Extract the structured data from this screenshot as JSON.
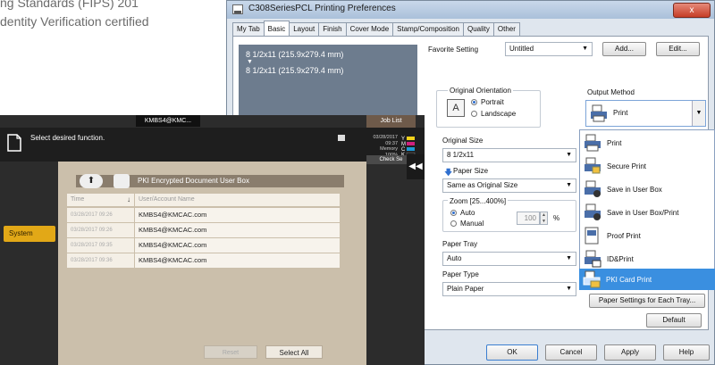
{
  "background": {
    "line1": "ng Standards (FIPS) 201",
    "line2": "dentity Verification certified"
  },
  "dialog": {
    "title": "C308SeriesPCL Printing Preferences",
    "close_label": "x",
    "tabs": [
      "My Tab",
      "Basic",
      "Layout",
      "Finish",
      "Cover Mode",
      "Stamp/Composition",
      "Quality",
      "Other"
    ],
    "active_tab": "Basic",
    "preview_line1": "8 1/2x11 (215.9x279.4 mm)",
    "preview_line2": "8 1/2x11 (215.9x279.4 mm)",
    "favorite_label": "Favorite Setting",
    "favorite_value": "Untitled",
    "add_button": "Add...",
    "edit_button": "Edit...",
    "orientation_label": "Original Orientation",
    "portrait_label": "Portrait",
    "landscape_label": "Landscape",
    "original_size_label": "Original Size",
    "original_size_value": "8 1/2x11",
    "paper_size_label": "Paper Size",
    "paper_size_value": "Same as Original Size",
    "zoom_label": "Zoom [25...400%]",
    "zoom_auto": "Auto",
    "zoom_manual": "Manual",
    "zoom_value": "100",
    "zoom_unit": "%",
    "paper_tray_label": "Paper Tray",
    "paper_tray_value": "Auto",
    "paper_type_label": "Paper Type",
    "paper_type_value": "Plain Paper",
    "output_method_label": "Output Method",
    "output_method_value": "Print",
    "output_options": [
      "Print",
      "Secure Print",
      "Save in User Box",
      "Save in User Box/Print",
      "Proof Print",
      "ID&Print",
      "PKI Card Print"
    ],
    "selected_output": "PKI Card Print",
    "paper_settings_button": "Paper Settings for Each Tray...",
    "default_button": "Default",
    "ok_button": "OK",
    "cancel_button": "Cancel",
    "apply_button": "Apply",
    "help_button": "Help"
  },
  "panel": {
    "top_tab": "KMBS4@KMC...",
    "job_list": "Job List",
    "header_text": "Select desired function.",
    "date": "03/28/2017",
    "time": "09:37",
    "memory_label": "Memory",
    "memory_value": "100%",
    "check_settings": "Check Se",
    "box_title": "PKI Encrypted Document User Box",
    "col_time": "Time",
    "col_user": "User/Account Name",
    "rows": [
      {
        "time": "03/28/2017 09:26",
        "user": "KMBS4@KMCAC.com"
      },
      {
        "time": "03/28/2017 09:26",
        "user": "KMBS4@KMCAC.com"
      },
      {
        "time": "03/28/2017 09:35",
        "user": "KMBS4@KMCAC.com"
      },
      {
        "time": "03/28/2017 09:36",
        "user": "KMBS4@KMCAC.com"
      }
    ],
    "system_button": "System",
    "reset_button": "Reset",
    "select_all_button": "Select All"
  },
  "colors": {
    "selection_blue": "#3a8fe0",
    "system_amber": "#e2a817",
    "panel_beige": "#cbbfab"
  }
}
